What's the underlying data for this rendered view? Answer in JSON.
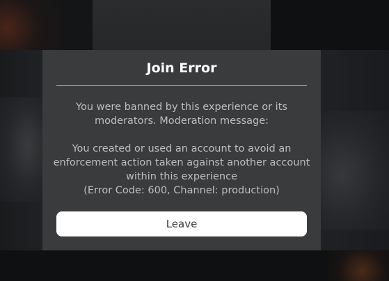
{
  "dialog": {
    "title": "Join Error",
    "message_lines": [
      "You were banned by this experience or its",
      "moderators. Moderation message:"
    ],
    "detail_lines": [
      "You created or used an account to avoid an",
      "enforcement action taken against another account",
      "within this experience",
      "(Error Code: 600, Channel: production)"
    ],
    "leave_label": "Leave"
  },
  "colors": {
    "modal_background": "#393b3d",
    "title_text": "#ffffff",
    "body_text": "#bdbebe",
    "button_background": "#ffffff",
    "button_text": "#393b3d",
    "divider": "#bdbebe"
  }
}
